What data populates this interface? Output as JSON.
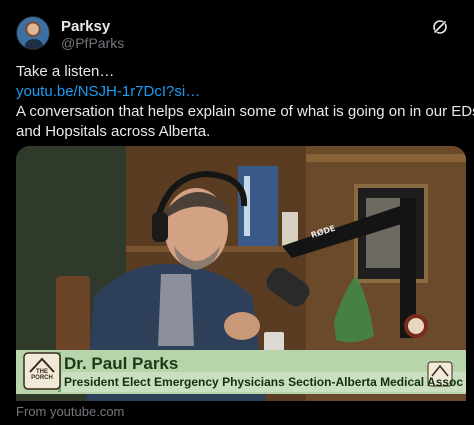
{
  "author": {
    "display_name": "Parksy",
    "handle": "@PfParks",
    "avatar_icon": "profile-photo",
    "action_icon": "grok-icon"
  },
  "tweet": {
    "line1": "Take a listen…",
    "link": "youtu.be/NSJH-1r7DcI?si…",
    "line3": "A conversation that helps explain some of what is going on in our EDs",
    "line4": "and Hopsitals across Alberta."
  },
  "video": {
    "lower_third_name": "Dr. Paul Parks",
    "lower_third_title": "President Elect Emergency Physicians Section-Alberta Medical Assoc",
    "logo_text": "THE PORCH",
    "mic_brand": "RØDE",
    "colors": {
      "lower_third_band": "#c9dfbf",
      "lower_third_accent": "#6ca86a"
    }
  },
  "card": {
    "source": "From youtube.com"
  }
}
